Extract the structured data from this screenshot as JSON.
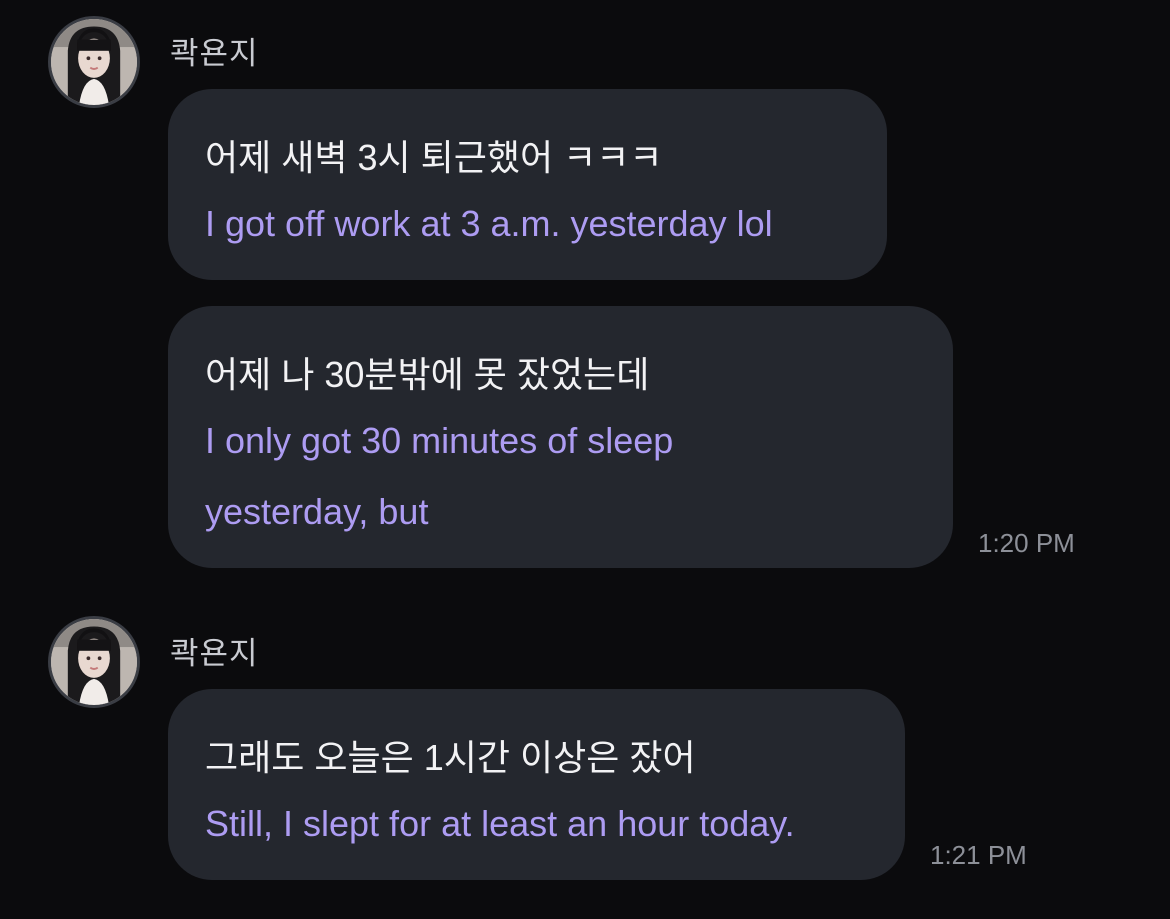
{
  "messages": [
    {
      "sender": "콱욘지",
      "avatar_icon": "profile-photo-icon",
      "bubbles": [
        {
          "korean": "어제 새벽 3시 퇴근했어 ㅋㅋㅋ",
          "english": "I got off work at 3 a.m. yesterday lol"
        },
        {
          "korean": "어제 나 30분밖에 못 잤었는데",
          "english_line1": "I only got 30 minutes of sleep",
          "english_line2": "yesterday, but"
        }
      ],
      "time": "1:20 PM"
    },
    {
      "sender": "콱욘지",
      "avatar_icon": "profile-photo-icon",
      "bubbles": [
        {
          "korean": "그래도 오늘은 1시간 이상은 잤어",
          "english": "Still, I slept for at least an hour today."
        }
      ],
      "time": "1:21 PM"
    }
  ],
  "colors": {
    "background": "#0b0b0d",
    "bubble": "#24272e",
    "translation_text": "#ad9cf2",
    "timestamp": "#8d9098"
  }
}
